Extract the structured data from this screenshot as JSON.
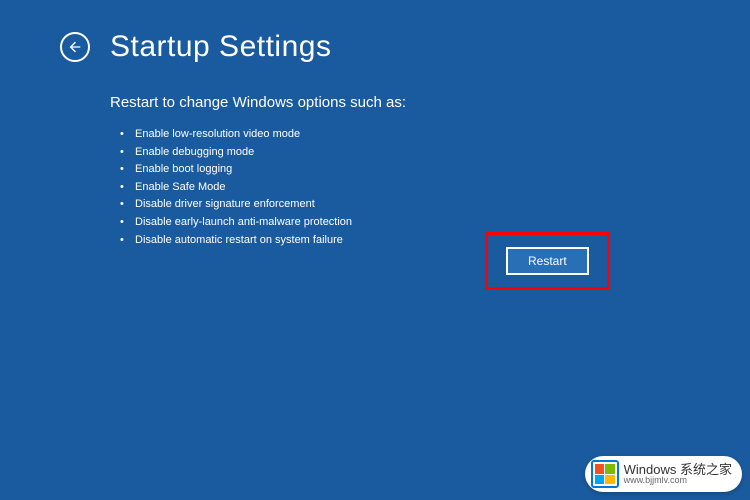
{
  "header": {
    "title": "Startup Settings"
  },
  "content": {
    "subtitle": "Restart to change Windows options such as:",
    "options": [
      "Enable low-resolution video mode",
      "Enable debugging mode",
      "Enable boot logging",
      "Enable Safe Mode",
      "Disable driver signature enforcement",
      "Disable early-launch anti-malware protection",
      "Disable automatic restart on system failure"
    ]
  },
  "actions": {
    "restart_label": "Restart"
  },
  "watermark": {
    "brand": "Windows 系统之家",
    "url": "www.bjjmlv.com"
  }
}
